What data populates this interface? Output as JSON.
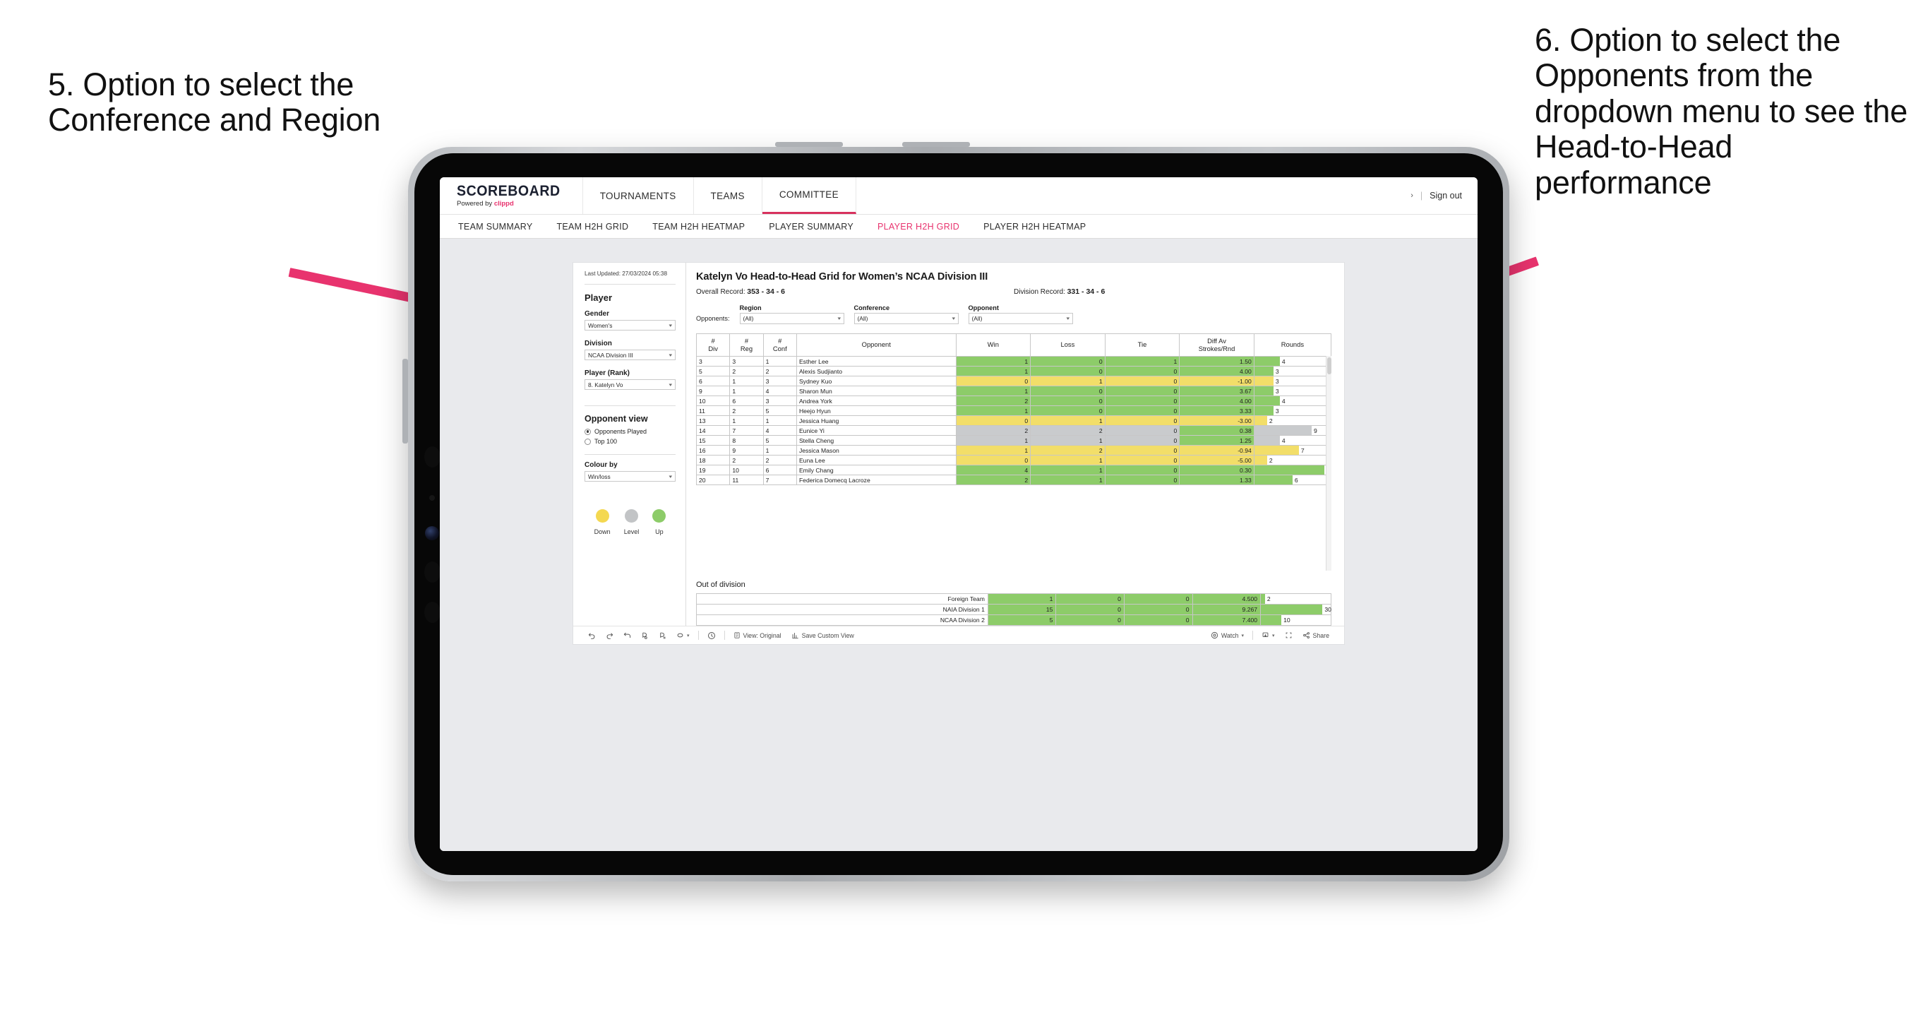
{
  "annotations": {
    "left": "5. Option to select the Conference and Region",
    "right": "6. Option to select the Opponents from the dropdown menu to see the Head-to-Head performance"
  },
  "header": {
    "brand_title": "SCOREBOARD",
    "brand_powered": "Powered by ",
    "brand_name": "clippd",
    "nav": [
      {
        "label": "TOURNAMENTS",
        "active": false
      },
      {
        "label": "TEAMS",
        "active": false
      },
      {
        "label": "COMMITTEE",
        "active": true
      }
    ],
    "user_chevron": "›",
    "separator": "|",
    "sign_out": "Sign out"
  },
  "sub_nav": [
    {
      "label": "TEAM SUMMARY",
      "active": false
    },
    {
      "label": "TEAM H2H GRID",
      "active": false
    },
    {
      "label": "TEAM H2H HEATMAP",
      "active": false
    },
    {
      "label": "PLAYER SUMMARY",
      "active": false
    },
    {
      "label": "PLAYER H2H GRID",
      "active": true
    },
    {
      "label": "PLAYER H2H HEATMAP",
      "active": false
    }
  ],
  "sidebar": {
    "last_updated": "Last Updated: 27/03/2024 05:38",
    "player_heading": "Player",
    "gender": {
      "label": "Gender",
      "value": "Women's"
    },
    "division": {
      "label": "Division",
      "value": "NCAA Division III"
    },
    "player_rank": {
      "label": "Player (Rank)",
      "value": "8. Katelyn Vo"
    },
    "opponent_view": {
      "heading": "Opponent view",
      "options": [
        {
          "label": "Opponents Played",
          "selected": true
        },
        {
          "label": "Top 100",
          "selected": false
        }
      ]
    },
    "colour_by": {
      "label": "Colour by",
      "value": "Win/loss"
    },
    "legend": [
      {
        "label": "Down",
        "color": "#f4d851"
      },
      {
        "label": "Level",
        "color": "#c2c4c6"
      },
      {
        "label": "Up",
        "color": "#8dcc69"
      }
    ]
  },
  "content": {
    "title": "Katelyn Vo Head-to-Head Grid for Women’s NCAA Division III",
    "overall_record_label": "Overall Record: ",
    "overall_record_value": "353 - 34 - 6",
    "division_record_label": "Division Record: ",
    "division_record_value": "331 - 34 - 6",
    "opponents_label": "Opponents:",
    "filters": [
      {
        "label": "Region",
        "value": "(All)"
      },
      {
        "label": "Conference",
        "value": "(All)"
      },
      {
        "label": "Opponent",
        "value": "(All)"
      }
    ],
    "grid_headers": [
      "#\nDiv",
      "#\nReg",
      "#\nConf",
      "Opponent",
      "Win",
      "Loss",
      "Tie",
      "Diff Av\nStrokes/Rnd",
      "Rounds"
    ],
    "out_of_division_title": "Out of division"
  },
  "chart_data": {
    "type": "table",
    "title": "Katelyn Vo Head-to-Head Grid for Women’s NCAA Division III",
    "columns": [
      "# Div",
      "# Reg",
      "# Conf",
      "Opponent",
      "Win",
      "Loss",
      "Tie",
      "Diff Av Strokes/Rnd",
      "Rounds"
    ],
    "colour_scale": {
      "up": "#8dcc69",
      "level": "#c9cbcd",
      "down": "#f2de69"
    },
    "rounds_max": 12,
    "rows": [
      {
        "div": "3",
        "reg": "3",
        "conf": "1",
        "opponent": "Esther Lee",
        "win": "1",
        "loss": "0",
        "tie": "1",
        "diff": "1.50",
        "rounds": "4",
        "color": "up"
      },
      {
        "div": "5",
        "reg": "2",
        "conf": "2",
        "opponent": "Alexis Sudjianto",
        "win": "1",
        "loss": "0",
        "tie": "0",
        "diff": "4.00",
        "rounds": "3",
        "color": "up"
      },
      {
        "div": "6",
        "reg": "1",
        "conf": "3",
        "opponent": "Sydney Kuo",
        "win": "0",
        "loss": "1",
        "tie": "0",
        "diff": "-1.00",
        "rounds": "3",
        "color": "down"
      },
      {
        "div": "9",
        "reg": "1",
        "conf": "4",
        "opponent": "Sharon Mun",
        "win": "1",
        "loss": "0",
        "tie": "0",
        "diff": "3.67",
        "rounds": "3",
        "color": "up"
      },
      {
        "div": "10",
        "reg": "6",
        "conf": "3",
        "opponent": "Andrea York",
        "win": "2",
        "loss": "0",
        "tie": "0",
        "diff": "4.00",
        "rounds": "4",
        "color": "up"
      },
      {
        "div": "11",
        "reg": "2",
        "conf": "5",
        "opponent": "Heejo Hyun",
        "win": "1",
        "loss": "0",
        "tie": "0",
        "diff": "3.33",
        "rounds": "3",
        "color": "up"
      },
      {
        "div": "13",
        "reg": "1",
        "conf": "1",
        "opponent": "Jessica Huang",
        "win": "0",
        "loss": "1",
        "tie": "0",
        "diff": "-3.00",
        "rounds": "2",
        "color": "down"
      },
      {
        "div": "14",
        "reg": "7",
        "conf": "4",
        "opponent": "Eunice Yi",
        "win": "2",
        "loss": "2",
        "tie": "0",
        "diff": "0.38",
        "rounds": "9",
        "color": "level",
        "diff_color": "up"
      },
      {
        "div": "15",
        "reg": "8",
        "conf": "5",
        "opponent": "Stella Cheng",
        "win": "1",
        "loss": "1",
        "tie": "0",
        "diff": "1.25",
        "rounds": "4",
        "color": "level",
        "diff_color": "up"
      },
      {
        "div": "16",
        "reg": "9",
        "conf": "1",
        "opponent": "Jessica Mason",
        "win": "1",
        "loss": "2",
        "tie": "0",
        "diff": "-0.94",
        "rounds": "7",
        "color": "down"
      },
      {
        "div": "18",
        "reg": "2",
        "conf": "2",
        "opponent": "Euna Lee",
        "win": "0",
        "loss": "1",
        "tie": "0",
        "diff": "-5.00",
        "rounds": "2",
        "color": "down"
      },
      {
        "div": "19",
        "reg": "10",
        "conf": "6",
        "opponent": "Emily Chang",
        "win": "4",
        "loss": "1",
        "tie": "0",
        "diff": "0.30",
        "rounds": "11",
        "color": "up"
      },
      {
        "div": "20",
        "reg": "11",
        "conf": "7",
        "opponent": "Federica Domecq Lacroze",
        "win": "2",
        "loss": "1",
        "tie": "0",
        "diff": "1.33",
        "rounds": "6",
        "color": "up"
      }
    ],
    "out_of_division": {
      "rounds_max": 34,
      "rows": [
        {
          "name": "Foreign Team",
          "win": "1",
          "loss": "0",
          "tie": "0",
          "diff": "4.500",
          "rounds": "2",
          "color": "up"
        },
        {
          "name": "NAIA Division 1",
          "win": "15",
          "loss": "0",
          "tie": "0",
          "diff": "9.267",
          "rounds": "30",
          "color": "up"
        },
        {
          "name": "NCAA Division 2",
          "win": "5",
          "loss": "0",
          "tie": "0",
          "diff": "7.400",
          "rounds": "10",
          "color": "up"
        }
      ]
    }
  },
  "toolbar": {
    "view_label": "View: Original",
    "save_label": "Save Custom View",
    "watch_label": "Watch",
    "share_label": "Share"
  }
}
